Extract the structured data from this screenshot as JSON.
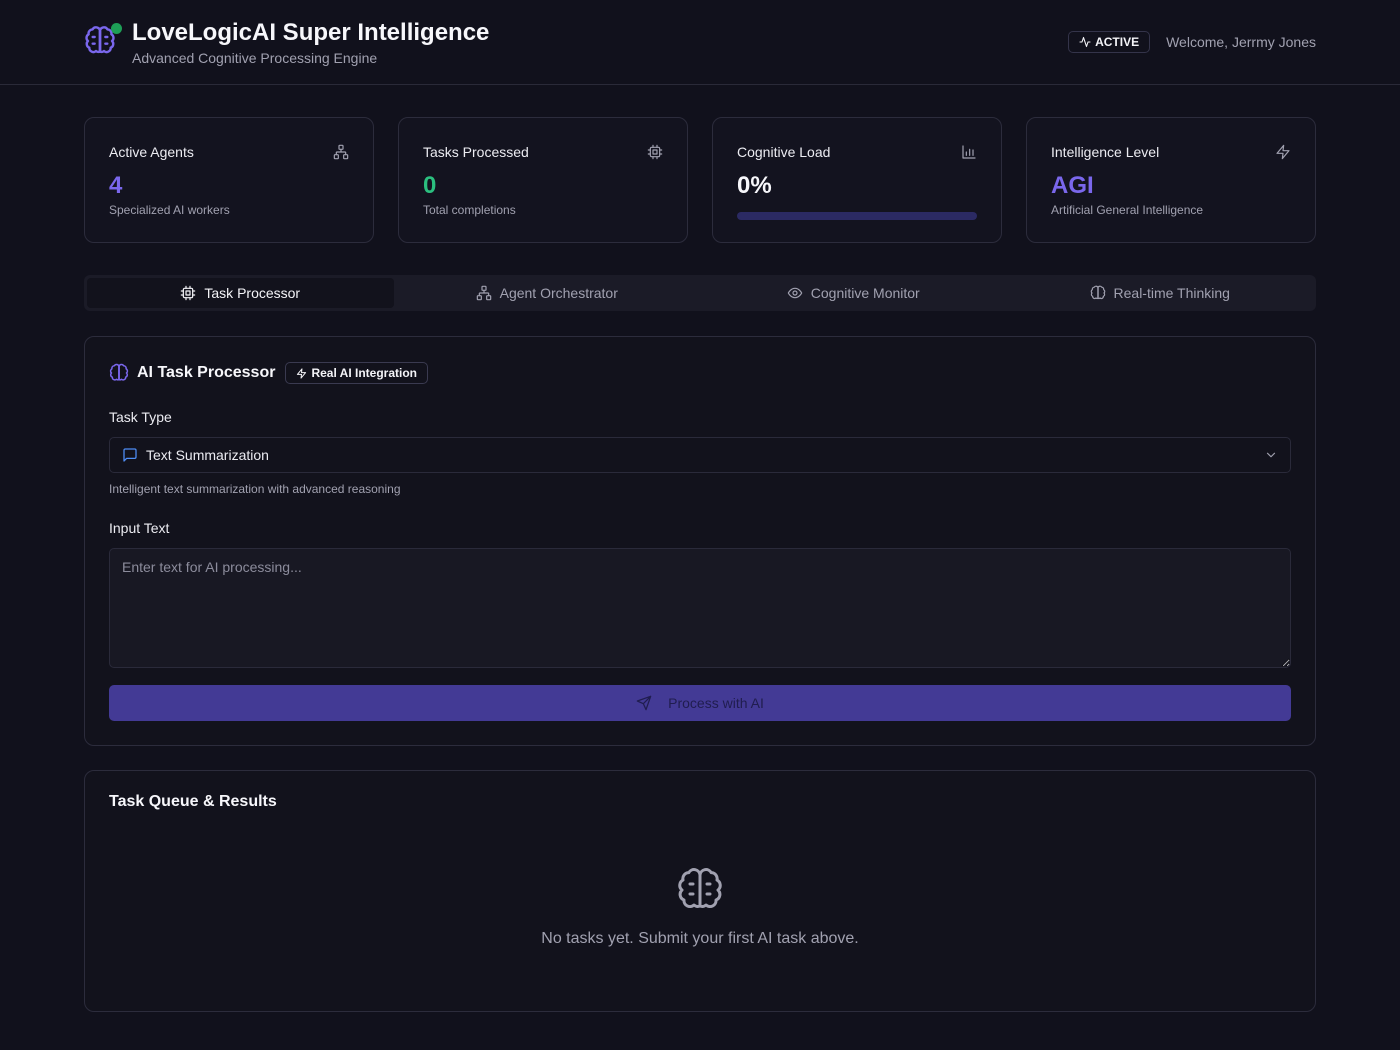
{
  "header": {
    "title": "LoveLogicAI Super Intelligence",
    "subtitle": "Advanced Cognitive Processing Engine",
    "status": "ACTIVE",
    "welcome": "Welcome, Jerrmy Jones",
    "logo_icon": "brain-icon",
    "status_dot_color": "#1e9f57"
  },
  "stats": [
    {
      "label": "Active Agents",
      "value": "4",
      "note": "Specialized AI workers",
      "icon": "network-icon"
    },
    {
      "label": "Tasks Processed",
      "value": "0",
      "note": "Total completions",
      "icon": "cpu-icon"
    },
    {
      "label": "Cognitive Load",
      "value": "0%",
      "progress": 0,
      "icon": "bar-chart-icon"
    },
    {
      "label": "Intelligence Level",
      "value": "AGI",
      "note": "Artificial General Intelligence",
      "icon": "lightning-icon"
    }
  ],
  "tabs": [
    {
      "label": "Task Processor",
      "icon": "cpu-icon",
      "active": true
    },
    {
      "label": "Agent Orchestrator",
      "icon": "network-icon",
      "active": false
    },
    {
      "label": "Cognitive Monitor",
      "icon": "eye-icon",
      "active": false
    },
    {
      "label": "Real-time Thinking",
      "icon": "brain-icon",
      "active": false
    }
  ],
  "processor": {
    "title": "AI Task Processor",
    "badge": "Real AI Integration",
    "task_type_label": "Task Type",
    "task_type_value": "Text Summarization",
    "task_type_hint": "Intelligent text summarization with advanced reasoning",
    "input_label": "Input Text",
    "input_placeholder": "Enter text for AI processing...",
    "input_value": "",
    "submit_label": "Process with AI"
  },
  "queue": {
    "title": "Task Queue & Results",
    "empty_text": "No tasks yet. Submit your first AI task above."
  },
  "colors": {
    "accent": "#7a67ec",
    "success": "#2bbf7f",
    "background": "#11111c",
    "button": "#433a95"
  }
}
